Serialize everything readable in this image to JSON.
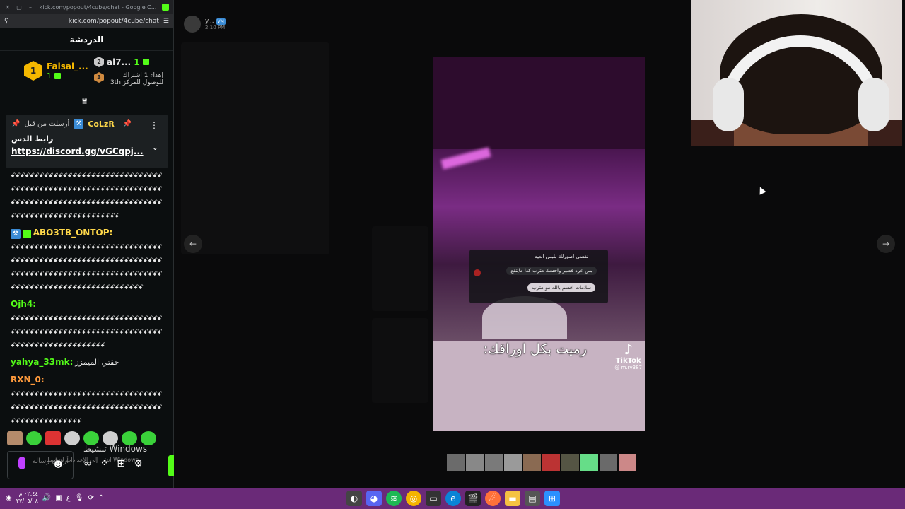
{
  "browser": {
    "tab_title": "kick.com/popout/4cube/chat - Google C...",
    "url": "kick.com/popout/4cube/chat"
  },
  "chat": {
    "title": "الدردشة",
    "leaderboard": {
      "first": {
        "rank": "1",
        "name": "Faisal_...",
        "count": "1"
      },
      "second": {
        "rank": "2",
        "name": "al7...",
        "count": "1"
      },
      "third": {
        "rank": "3",
        "text": "إهداء 1 اشتراك للوصول للمركز 3th"
      }
    },
    "pinned": {
      "label": "أرسلت من قبل",
      "user": "CoLzR",
      "body": "رابط الدس",
      "link": "https://discord.gg/vGCqpj..."
    },
    "messages": [
      {
        "user": "",
        "text": "ꗃꗃꗃꗃꗃꗃꗃꗃꗃꗃꗃꗃꗃꗃꗃꗃꗃꗃꗃꗃꗃꗃꗃꗃꗃꗃꗃꗃꗃꗃꗃꗃꗃꗃꗃꗃꗃꗃꗃꗃꗃꗃꗃꗃꗃꗃꗃꗃꗃꗃꗃꗃꗃꗃꗃꗃꗃꗃꗃꗃꗃꗃꗃꗃꗃꗃꗃꗃꗃꗃꗃꗃꗃꗃꗃꗃꗃꗃꗃꗃꗃꗃꗃꗃꗃꗃꗃꗃꗃꗃꗃꗃꗃꗃꗃꗃꗃꗃꗃꗃꗃꗃꗃꗃꗃꗃꗃꗃꗃꗃꗃꗃꗃꗃꗃꗃꗃꗃꗃ",
        "color": "#e6e6e6"
      },
      {
        "user": "ABO3TB_ONTOP:",
        "text": "ꗃꗃꗃꗃꗃꗃꗃꗃꗃꗃꗃꗃꗃꗃꗃꗃꗃꗃꗃꗃꗃꗃꗃꗃꗃꗃꗃꗃꗃꗃꗃꗃꗃꗃꗃꗃꗃꗃꗃꗃꗃꗃꗃꗃꗃꗃꗃꗃꗃꗃꗃꗃꗃꗃꗃꗃꗃꗃꗃꗃꗃꗃꗃꗃꗃꗃꗃꗃꗃꗃꗃꗃꗃꗃꗃꗃꗃꗃꗃꗃꗃꗃꗃꗃꗃꗃꗃꗃꗃꗃꗃꗃꗃꗃꗃꗃꗃꗃꗃꗃꗃꗃꗃꗃꗃꗃꗃꗃꗃꗃꗃꗃꗃꗃꗃꗃꗃꗃꗃꗃꗃꗃꗃꗃ",
        "color": "#ffd84a"
      },
      {
        "user": "Ojh4:",
        "text": "ꗃꗃꗃꗃꗃꗃꗃꗃꗃꗃꗃꗃꗃꗃꗃꗃꗃꗃꗃꗃꗃꗃꗃꗃꗃꗃꗃꗃꗃꗃꗃꗃꗃꗃꗃꗃꗃꗃꗃꗃꗃꗃꗃꗃꗃꗃꗃꗃꗃꗃꗃꗃꗃꗃꗃꗃꗃꗃꗃꗃꗃꗃꗃꗃꗃꗃꗃꗃꗃꗃꗃꗃꗃꗃꗃꗃꗃꗃꗃꗃꗃꗃꗃꗃ",
        "color": "#53fc18"
      },
      {
        "user": "yahya_33mk:",
        "text": "حقتي الميمزز",
        "color": "#53fc18"
      },
      {
        "user": "RXN_0:",
        "text": "ꗃꗃꗃꗃꗃꗃꗃꗃꗃꗃꗃꗃꗃꗃꗃꗃꗃꗃꗃꗃꗃꗃꗃꗃꗃꗃꗃꗃꗃꗃꗃꗃꗃꗃꗃꗃꗃꗃꗃꗃꗃꗃꗃꗃꗃꗃꗃꗃꗃꗃꗃꗃꗃꗃꗃꗃꗃꗃꗃꗃꗃꗃꗃꗃꗃꗃꗃꗃꗃꗃꗃꗃꗃꗃꗃꗃꗃꗃꗃ",
        "color": "#ff9a3c"
      }
    ],
    "input_placeholder": "أرسل رسالة",
    "windows_activate": "تنشيط Windows",
    "windows_activate_sub": "انتقل إلى الإعدادات لتنشيط Windows."
  },
  "post": {
    "user": "y...",
    "badge": "VM",
    "time": "2:10 PM"
  },
  "tiktok": {
    "comment1": "نفسي اصورلك بلبس العيد",
    "comment2": "بس عره قصير واحسك مترب كذا مايتقع",
    "comment3": "سلامات اقسم بالله مو مترب",
    "caption": "رميت بكل اوراقك:",
    "brand": "TikTok",
    "handle": "@ m.rv387"
  },
  "taskbar": {
    "time": "٠٢:٤٤ م",
    "date": "٢٧/٠٥/٠٨",
    "lang": "ع"
  },
  "colors": {
    "kick_green": "#53fc18",
    "taskbar": "#6a2a78",
    "gold": "#f5b800"
  }
}
